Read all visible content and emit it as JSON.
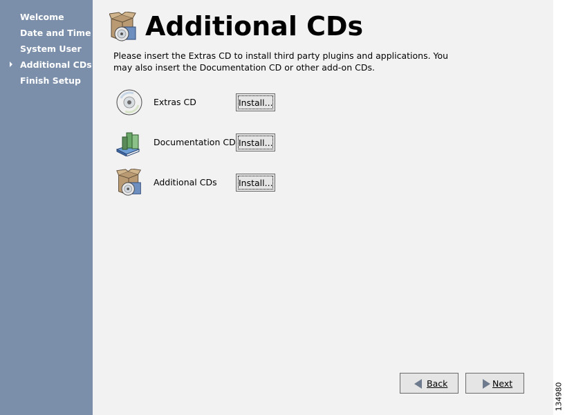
{
  "sidebar": {
    "items": [
      {
        "label": "Welcome",
        "current": false
      },
      {
        "label": "Date and Time",
        "current": false
      },
      {
        "label": "System User",
        "current": false
      },
      {
        "label": "Additional CDs",
        "current": true
      },
      {
        "label": "Finish Setup",
        "current": false
      }
    ]
  },
  "header": {
    "title": "Additional CDs",
    "icon": "box-with-cd-icon"
  },
  "main": {
    "description": "Please insert the Extras CD to install third party plugins and applications.  You may also insert the Documentation CD or other add-on CDs.",
    "cds": [
      {
        "label": "Extras CD",
        "icon": "cd-icon",
        "button": "Install..."
      },
      {
        "label": "Documentation CD",
        "icon": "books-icon",
        "button": "Install..."
      },
      {
        "label": "Additional CDs",
        "icon": "box-with-cd-icon",
        "button": "Install..."
      }
    ]
  },
  "footer": {
    "back_label": "Back",
    "next_label": "Next"
  },
  "figure_id": "134980",
  "colors": {
    "sidebar": "#7b8fab",
    "main_bg": "#f2f2f2",
    "button": "#e5e5e5"
  }
}
